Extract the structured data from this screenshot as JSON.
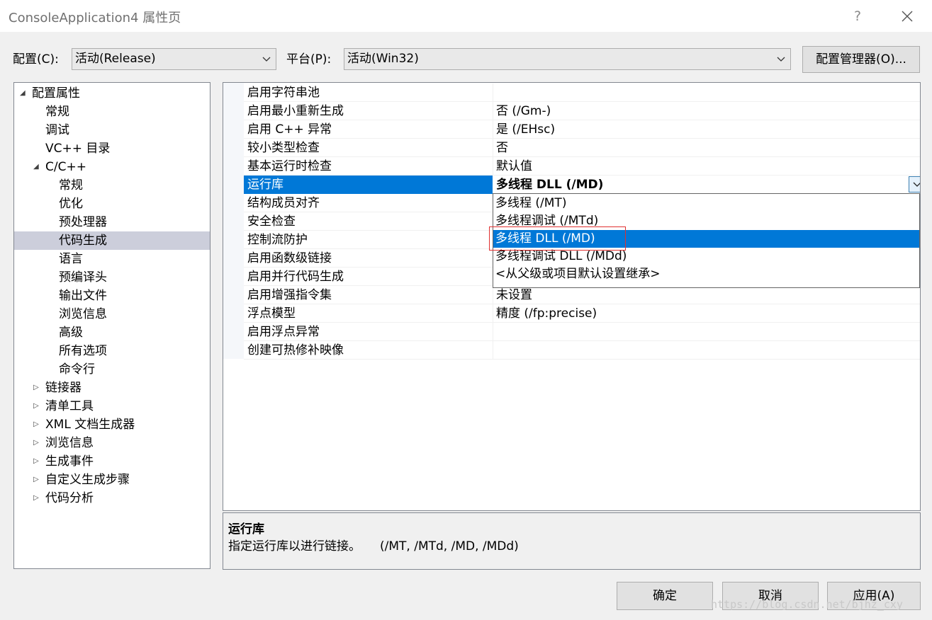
{
  "window": {
    "title": "ConsoleApplication4 属性页",
    "help_label": "?"
  },
  "toolbar": {
    "config_label": "配置(C):",
    "config_value": "活动(Release)",
    "platform_label": "平台(P):",
    "platform_value": "活动(Win32)",
    "config_manager_label": "配置管理器(O)..."
  },
  "tree": {
    "items": [
      {
        "label": "配置属性",
        "level": 0,
        "state": "expanded"
      },
      {
        "label": "常规",
        "level": 1,
        "state": "none"
      },
      {
        "label": "调试",
        "level": 1,
        "state": "none"
      },
      {
        "label": "VC++ 目录",
        "level": 1,
        "state": "none"
      },
      {
        "label": "C/C++",
        "level": 1,
        "state": "expanded"
      },
      {
        "label": "常规",
        "level": 2,
        "state": "none"
      },
      {
        "label": "优化",
        "level": 2,
        "state": "none"
      },
      {
        "label": "预处理器",
        "level": 2,
        "state": "none"
      },
      {
        "label": "代码生成",
        "level": 2,
        "state": "none",
        "selected": true
      },
      {
        "label": "语言",
        "level": 2,
        "state": "none"
      },
      {
        "label": "预编译头",
        "level": 2,
        "state": "none"
      },
      {
        "label": "输出文件",
        "level": 2,
        "state": "none"
      },
      {
        "label": "浏览信息",
        "level": 2,
        "state": "none"
      },
      {
        "label": "高级",
        "level": 2,
        "state": "none"
      },
      {
        "label": "所有选项",
        "level": 2,
        "state": "none"
      },
      {
        "label": "命令行",
        "level": 2,
        "state": "none"
      },
      {
        "label": "链接器",
        "level": 1,
        "state": "collapsed"
      },
      {
        "label": "清单工具",
        "level": 1,
        "state": "collapsed"
      },
      {
        "label": "XML 文档生成器",
        "level": 1,
        "state": "collapsed"
      },
      {
        "label": "浏览信息",
        "level": 1,
        "state": "collapsed"
      },
      {
        "label": "生成事件",
        "level": 1,
        "state": "collapsed"
      },
      {
        "label": "自定义生成步骤",
        "level": 1,
        "state": "collapsed"
      },
      {
        "label": "代码分析",
        "level": 1,
        "state": "collapsed"
      }
    ]
  },
  "grid": {
    "rows": [
      {
        "name": "启用字符串池",
        "value": ""
      },
      {
        "name": "启用最小重新生成",
        "value": "否 (/Gm-)"
      },
      {
        "name": "启用 C++ 异常",
        "value": "是 (/EHsc)"
      },
      {
        "name": "较小类型检查",
        "value": "否"
      },
      {
        "name": "基本运行时检查",
        "value": "默认值"
      },
      {
        "name": "运行库",
        "value": "多线程 DLL (/MD)",
        "selected": true
      },
      {
        "name": "结构成员对齐",
        "value": ""
      },
      {
        "name": "安全检查",
        "value": ""
      },
      {
        "name": "控制流防护",
        "value": ""
      },
      {
        "name": "启用函数级链接",
        "value": ""
      },
      {
        "name": "启用并行代码生成",
        "value": ""
      },
      {
        "name": "启用增强指令集",
        "value": "未设置"
      },
      {
        "name": "浮点模型",
        "value": "精度 (/fp:precise)"
      },
      {
        "name": "启用浮点异常",
        "value": ""
      },
      {
        "name": "创建可热修补映像",
        "value": ""
      }
    ]
  },
  "dropdown": {
    "options": [
      {
        "label": "多线程 (/MT)"
      },
      {
        "label": "多线程调试 (/MTd)"
      },
      {
        "label": "多线程 DLL (/MD)",
        "highlighted": true
      },
      {
        "label": "多线程调试 DLL (/MDd)"
      },
      {
        "label": "<从父级或项目默认设置继承>"
      }
    ]
  },
  "description": {
    "title": "运行库",
    "text": "指定运行库以进行链接。     (/MT, /MTd, /MD, /MDd)"
  },
  "buttons": {
    "ok_label": "确定",
    "cancel_label": "取消",
    "apply_label": "应用(A)"
  },
  "watermark": "https://blog.csdn.net/bjhz_cxy",
  "colors": {
    "selection": "#0078d7",
    "tree_selection": "#cccedb",
    "highlight_box": "#e03030"
  }
}
